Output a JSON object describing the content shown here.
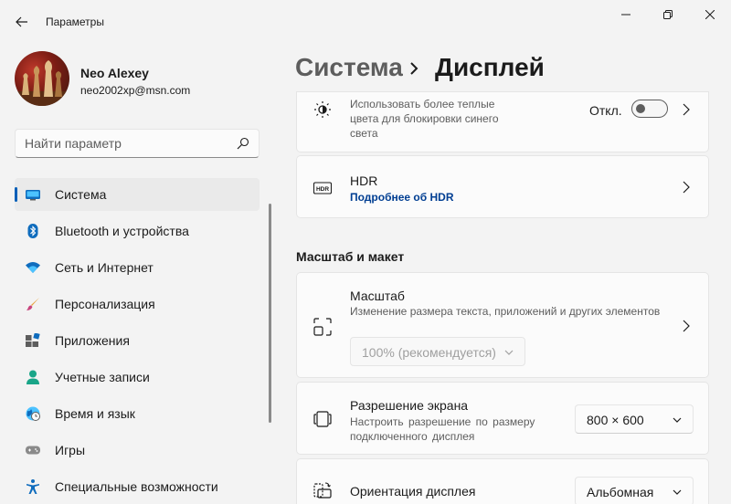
{
  "window": {
    "title": "Параметры"
  },
  "user": {
    "name": "Neo Alexey",
    "email": "neo2002xp@msn.com"
  },
  "search": {
    "placeholder": "Найти параметр"
  },
  "nav": {
    "items": [
      {
        "label": "Система",
        "icon": "system-icon",
        "active": true
      },
      {
        "label": "Bluetooth и устройства",
        "icon": "bluetooth-icon"
      },
      {
        "label": "Сеть и Интернет",
        "icon": "wifi-icon"
      },
      {
        "label": "Персонализация",
        "icon": "brush-icon"
      },
      {
        "label": "Приложения",
        "icon": "apps-icon"
      },
      {
        "label": "Учетные записи",
        "icon": "account-icon"
      },
      {
        "label": "Время и язык",
        "icon": "clock-globe-icon"
      },
      {
        "label": "Игры",
        "icon": "gamepad-icon"
      },
      {
        "label": "Специальные возможности",
        "icon": "accessibility-icon"
      }
    ]
  },
  "header": {
    "parent": "Система",
    "current": "Дисплей"
  },
  "night_light": {
    "text": "Использовать более теплые цвета для блокировки синего света",
    "line1": "Использовать более теплые",
    "line2": "цвета для блокировки синего",
    "line3": "света",
    "toggle_label": "Откл.",
    "enabled": false
  },
  "hdr": {
    "title": "HDR",
    "link": "Подробнее об HDR",
    "icon_text": "HDR"
  },
  "section": {
    "title": "Масштаб и макет"
  },
  "scale": {
    "title": "Масштаб",
    "desc": "Изменение размера текста, приложений и других элементов",
    "value": "100% (рекомендуется)"
  },
  "resolution": {
    "title": "Разрешение экрана",
    "desc_line1": "Настроить разрешение по размеру",
    "desc_line2": "подключенного дисплея",
    "value": "800 × 600"
  },
  "orientation": {
    "title": "Ориентация дисплея",
    "value": "Альбомная"
  },
  "colors": {
    "accent": "#005fb8",
    "background": "#f3f3f3",
    "card": "#fbfbfb"
  }
}
